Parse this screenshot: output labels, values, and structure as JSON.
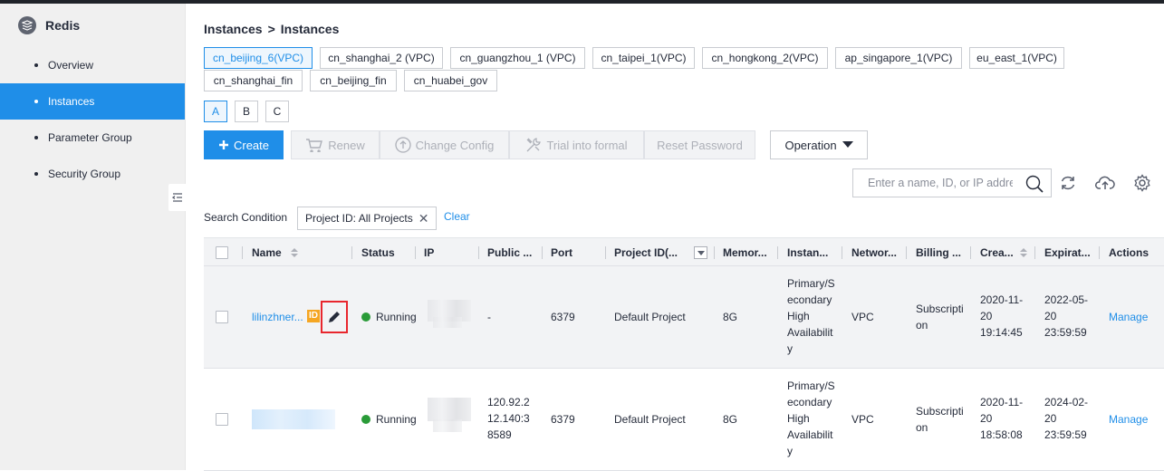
{
  "sidebar": {
    "title": "Redis",
    "items": [
      {
        "label": "Overview",
        "active": false
      },
      {
        "label": "Instances",
        "active": true
      },
      {
        "label": "Parameter Group",
        "active": false
      },
      {
        "label": "Security Group",
        "active": false
      }
    ]
  },
  "breadcrumb": {
    "parent": "Instances",
    "separator": ">",
    "current": "Instances"
  },
  "regions": [
    {
      "label": "cn_beijing_6(VPC)",
      "selected": true
    },
    {
      "label": "cn_shanghai_2 (VPC)",
      "selected": false
    },
    {
      "label": "cn_guangzhou_1 (VPC)",
      "selected": false
    },
    {
      "label": "cn_taipei_1(VPC)",
      "selected": false
    },
    {
      "label": "cn_hongkong_2(VPC)",
      "selected": false
    },
    {
      "label": "ap_singapore_1(VPC)",
      "selected": false
    },
    {
      "label": "eu_east_1(VPC)",
      "selected": false
    },
    {
      "label": "cn_shanghai_fin",
      "selected": false
    },
    {
      "label": "cn_beijing_fin",
      "selected": false
    },
    {
      "label": "cn_huabei_gov",
      "selected": false
    }
  ],
  "zones": [
    {
      "label": "A",
      "selected": true
    },
    {
      "label": "B",
      "selected": false
    },
    {
      "label": "C",
      "selected": false
    }
  ],
  "toolbar": {
    "create": "Create",
    "renew": "Renew",
    "change_config": "Change Config",
    "trial_into_formal": "Trial into formal",
    "reset_password": "Reset Password",
    "operation": "Operation"
  },
  "search": {
    "placeholder": "Enter a name, ID, or IP address"
  },
  "filter": {
    "label": "Search Condition",
    "tag": "Project ID: All Projects",
    "clear": "Clear"
  },
  "table": {
    "columns": [
      "Name",
      "Status",
      "IP",
      "Public ...",
      "Port",
      "Project ID(...",
      "Memor...",
      "Instan...",
      "Networ...",
      "Billing ...",
      "Crea...",
      "Expirat...",
      "Actions"
    ],
    "rows": [
      {
        "name": "lilinzhner...",
        "id_badge": "ID",
        "status": "Running",
        "public_ip": "-",
        "port": "6379",
        "project": "Default Project",
        "memory": "8G",
        "instance_type": [
          "Primary/S",
          "econdary",
          "High",
          "Availabilit",
          "y"
        ],
        "network": "VPC",
        "billing": [
          "Subscripti",
          "on"
        ],
        "created": [
          "2020-11-",
          "20",
          "19:14:45"
        ],
        "expiration": [
          "2022-05-",
          "20",
          "23:59:59"
        ],
        "action": "Manage"
      },
      {
        "name": "",
        "status": "Running",
        "public_ip": [
          "120.92.2",
          "12.140:3",
          "8589"
        ],
        "port": "6379",
        "project": "Default Project",
        "memory": "8G",
        "instance_type": [
          "Primary/S",
          "econdary",
          "High",
          "Availabilit",
          "y"
        ],
        "network": "VPC",
        "billing": [
          "Subscripti",
          "on"
        ],
        "created": [
          "2020-11-",
          "20",
          "18:58:08"
        ],
        "expiration": [
          "2024-02-",
          "20",
          "23:59:59"
        ],
        "action": "Manage"
      }
    ]
  },
  "colors": {
    "accent": "#1f8ee8",
    "running": "#2a9b38",
    "highlight": "#e8262d",
    "badge": "#f5a623"
  }
}
